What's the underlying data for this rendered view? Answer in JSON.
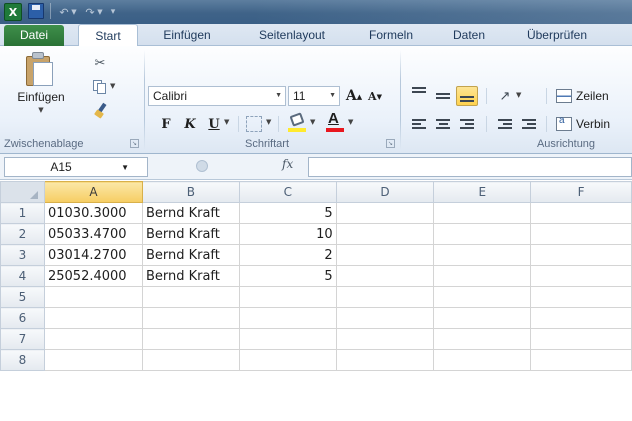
{
  "quick_access": {
    "app_logo": "X",
    "icons": [
      "excel-logo-icon",
      "save-icon",
      "undo-icon",
      "redo-icon",
      "customize-quick-access-icon"
    ]
  },
  "ribbon_tabs": [
    {
      "label": "Datei",
      "active": false
    },
    {
      "label": "Start",
      "active": true
    },
    {
      "label": "Einfügen",
      "active": false
    },
    {
      "label": "Seitenlayout",
      "active": false
    },
    {
      "label": "Formeln",
      "active": false
    },
    {
      "label": "Daten",
      "active": false
    },
    {
      "label": "Überprüfen",
      "active": false
    }
  ],
  "clipboard": {
    "paste_label": "Einfügen",
    "group_label": "Zwischenablage"
  },
  "font": {
    "font_name": "Calibri",
    "font_size": "11",
    "grow_label": "A",
    "shrink_label": "A",
    "bold_label": "F",
    "italic_label": "K",
    "underline_label": "U",
    "font_color_label": "A",
    "group_label": "Schriftart"
  },
  "alignment": {
    "wrap_label": "Zeilen",
    "merge_label": "Verbin",
    "group_label": "Ausrichtung"
  },
  "formula_bar": {
    "name_box": "A15",
    "fx_label": "fx",
    "formula": ""
  },
  "sheet": {
    "columns": [
      "A",
      "B",
      "C",
      "D",
      "E",
      "F"
    ],
    "selected_column": "A",
    "rows": [
      {
        "num": "1",
        "cells": [
          "01030.3000",
          "Bernd Kraft",
          "5",
          "",
          "",
          ""
        ]
      },
      {
        "num": "2",
        "cells": [
          "05033.4700",
          "Bernd Kraft",
          "10",
          "",
          "",
          ""
        ]
      },
      {
        "num": "3",
        "cells": [
          "03014.2700",
          "Bernd Kraft",
          "2",
          "",
          "",
          ""
        ]
      },
      {
        "num": "4",
        "cells": [
          "25052.4000",
          "Bernd Kraft",
          "5",
          "",
          "",
          ""
        ]
      },
      {
        "num": "5",
        "cells": [
          "",
          "",
          "",
          "",
          "",
          ""
        ]
      },
      {
        "num": "6",
        "cells": [
          "",
          "",
          "",
          "",
          "",
          ""
        ]
      },
      {
        "num": "7",
        "cells": [
          "",
          "",
          "",
          "",
          "",
          ""
        ]
      },
      {
        "num": "8",
        "cells": [
          "",
          "",
          "",
          "",
          "",
          ""
        ]
      }
    ]
  },
  "colors": {
    "title_bar": "#3f6388",
    "file_tab": "#2a7236",
    "selected_header": "#f6cd63",
    "font_color_bar": "#e8171f",
    "highlight_bar": "#ffea2e"
  }
}
